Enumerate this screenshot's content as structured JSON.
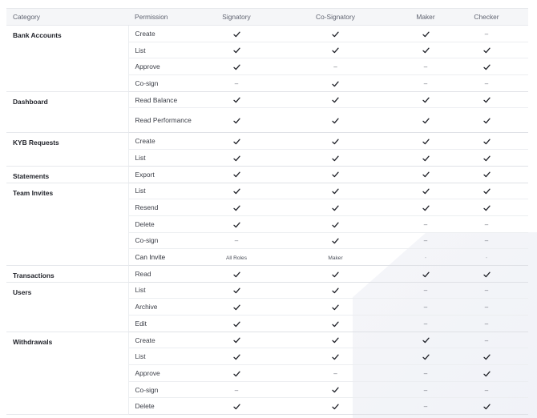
{
  "header": {
    "category": "Category",
    "permission": "Permission",
    "signatory": "Signatory",
    "co_signatory": "Co-Signatory",
    "maker": "Maker",
    "checker": "Checker"
  },
  "check_symbol": "check-icon",
  "dash_symbol": "–",
  "groups": [
    {
      "name": "Bank Accounts",
      "rows": [
        {
          "permission": "Create",
          "signatory": "✓",
          "co_signatory": "✓",
          "maker": "✓",
          "checker": "–"
        },
        {
          "permission": "List",
          "signatory": "✓",
          "co_signatory": "✓",
          "maker": "✓",
          "checker": "✓"
        },
        {
          "permission": "Approve",
          "signatory": "✓",
          "co_signatory": "–",
          "maker": "–",
          "checker": "✓"
        },
        {
          "permission": "Co-sign",
          "signatory": "–",
          "co_signatory": "✓",
          "maker": "–",
          "checker": "–"
        }
      ]
    },
    {
      "name": "Dashboard",
      "rows": [
        {
          "permission": "Read Balance",
          "signatory": "✓",
          "co_signatory": "✓",
          "maker": "✓",
          "checker": "✓"
        },
        {
          "permission": "Read Performance",
          "signatory": "✓",
          "co_signatory": "✓",
          "maker": "✓",
          "checker": "✓"
        }
      ]
    },
    {
      "name": "KYB Requests",
      "rows": [
        {
          "permission": "Create",
          "signatory": "✓",
          "co_signatory": "✓",
          "maker": "✓",
          "checker": "✓"
        },
        {
          "permission": "List",
          "signatory": "✓",
          "co_signatory": "✓",
          "maker": "✓",
          "checker": "✓"
        }
      ]
    },
    {
      "name": "Statements",
      "rows": [
        {
          "permission": "Export",
          "signatory": "✓",
          "co_signatory": "✓",
          "maker": "✓",
          "checker": "✓"
        }
      ]
    },
    {
      "name": "Team Invites",
      "rows": [
        {
          "permission": "List",
          "signatory": "✓",
          "co_signatory": "✓",
          "maker": "✓",
          "checker": "✓"
        },
        {
          "permission": "Resend",
          "signatory": "✓",
          "co_signatory": "✓",
          "maker": "✓",
          "checker": "✓"
        },
        {
          "permission": "Delete",
          "signatory": "✓",
          "co_signatory": "✓",
          "maker": "–",
          "checker": "–"
        },
        {
          "permission": "Co-sign",
          "signatory": "–",
          "co_signatory": "✓",
          "maker": "–",
          "checker": "–"
        },
        {
          "permission": "Can Invite",
          "signatory": "All Roles",
          "co_signatory": "Maker",
          "maker": "-",
          "checker": "-"
        }
      ]
    },
    {
      "name": "Transactions",
      "rows": [
        {
          "permission": "Read",
          "signatory": "✓",
          "co_signatory": "✓",
          "maker": "✓",
          "checker": "✓"
        }
      ]
    },
    {
      "name": "Users",
      "rows": [
        {
          "permission": "List",
          "signatory": "✓",
          "co_signatory": "✓",
          "maker": "–",
          "checker": "–"
        },
        {
          "permission": "Archive",
          "signatory": "✓",
          "co_signatory": "✓",
          "maker": "–",
          "checker": "–"
        },
        {
          "permission": "Edit",
          "signatory": "✓",
          "co_signatory": "✓",
          "maker": "–",
          "checker": "–"
        }
      ]
    },
    {
      "name": "Withdrawals",
      "rows": [
        {
          "permission": "Create",
          "signatory": "✓",
          "co_signatory": "✓",
          "maker": "✓",
          "checker": "–"
        },
        {
          "permission": "List",
          "signatory": "✓",
          "co_signatory": "✓",
          "maker": "✓",
          "checker": "✓"
        },
        {
          "permission": "Approve",
          "signatory": "✓",
          "co_signatory": "–",
          "maker": "–",
          "checker": "✓"
        },
        {
          "permission": "Co-sign",
          "signatory": "–",
          "co_signatory": "✓",
          "maker": "–",
          "checker": "–"
        },
        {
          "permission": "Delete",
          "signatory": "✓",
          "co_signatory": "✓",
          "maker": "–",
          "checker": "✓"
        }
      ]
    }
  ]
}
